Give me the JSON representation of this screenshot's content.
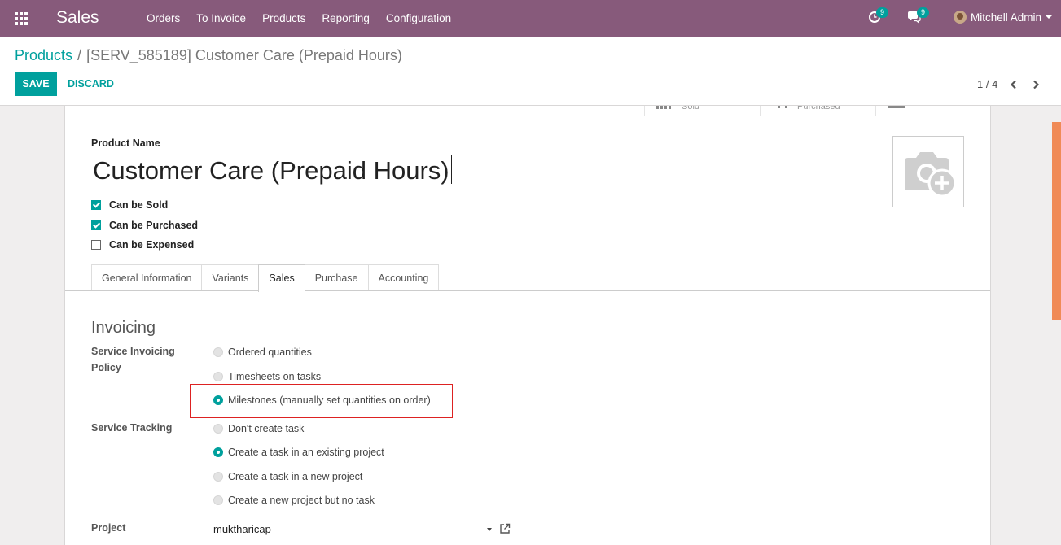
{
  "navbar": {
    "app_name": "Sales",
    "menu": [
      "Orders",
      "To Invoice",
      "Products",
      "Reporting",
      "Configuration"
    ],
    "activity_count": "9",
    "messages_count": "9",
    "user_name": "Mitchell Admin",
    "color": "#875a7b"
  },
  "breadcrumb": {
    "parent": "Products",
    "separator": "/",
    "current": "[SERV_585189] Customer Care (Prepaid Hours)"
  },
  "actions": {
    "save": "SAVE",
    "discard": "DISCARD"
  },
  "pager": {
    "value": "1 / 4"
  },
  "stat_buttons": [
    "Sold",
    "Purchased"
  ],
  "product": {
    "name_label": "Product Name",
    "name": "Customer Care (Prepaid Hours)",
    "options": [
      {
        "label": "Can be Sold",
        "checked": true
      },
      {
        "label": "Can be Purchased",
        "checked": true
      },
      {
        "label": "Can be Expensed",
        "checked": false
      }
    ]
  },
  "tabs": [
    "General Information",
    "Variants",
    "Sales",
    "Purchase",
    "Accounting"
  ],
  "active_tab": "Sales",
  "invoicing": {
    "title": "Invoicing",
    "policy_label": "Service Invoicing Policy",
    "policy_options": [
      {
        "label": "Ordered quantities",
        "selected": false
      },
      {
        "label": "Timesheets on tasks",
        "selected": false
      },
      {
        "label": "Milestones (manually set quantities on order)",
        "selected": true
      }
    ],
    "tracking_label": "Service Tracking",
    "tracking_options": [
      {
        "label": "Don't create task",
        "selected": false
      },
      {
        "label": "Create a task in an existing project",
        "selected": true
      },
      {
        "label": "Create a task in a new project",
        "selected": false
      },
      {
        "label": "Create a new project but no task",
        "selected": false
      }
    ],
    "project_label": "Project",
    "project_value": "muktharicap"
  },
  "colors": {
    "accent": "#00a09d",
    "brand": "#875a7b",
    "highlight": "#dd2222"
  }
}
